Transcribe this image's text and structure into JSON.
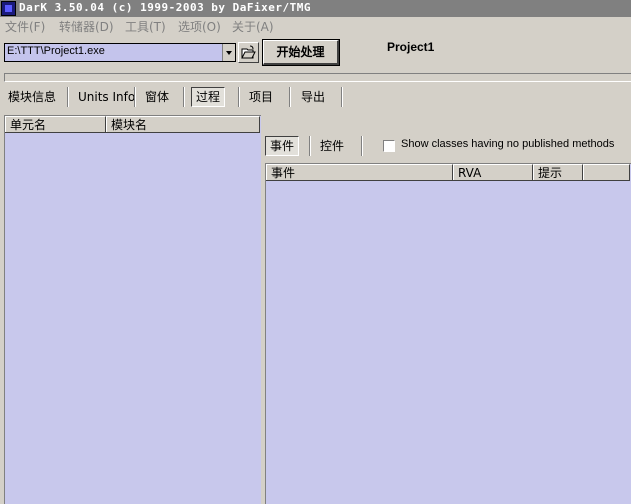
{
  "window": {
    "title": "DarK 3.50.04 (c) 1999-2003 by DaFixer/TMG"
  },
  "menu": [
    "文件(F)",
    "转储器(D)",
    "工具(T)",
    "选项(O)",
    "关于(A)"
  ],
  "toolbar": {
    "path_value": "E:\\TTT\\Project1.exe",
    "process_label": "开始处理",
    "project_name": "Project1"
  },
  "tabs": [
    "模块信息",
    "Units Info",
    "窗体",
    "过程",
    "项目",
    "导出"
  ],
  "active_tab": "过程",
  "left_list": {
    "columns": [
      "单元名",
      "模块名"
    ],
    "rows": []
  },
  "sub_tabs": [
    "事件",
    "控件"
  ],
  "checkbox": {
    "label": "Show classes having no published methods",
    "checked": false
  },
  "right_list": {
    "columns": [
      "事件",
      "RVA",
      "提示"
    ],
    "rows": []
  },
  "colors": {
    "list_bg": "#c8c8ec",
    "face": "#d4d0c8",
    "title_bg": "#808080"
  },
  "icons": {
    "app": "app-logo-icon",
    "open": "open-folder-icon",
    "dropdown": "chevron-down-icon"
  }
}
